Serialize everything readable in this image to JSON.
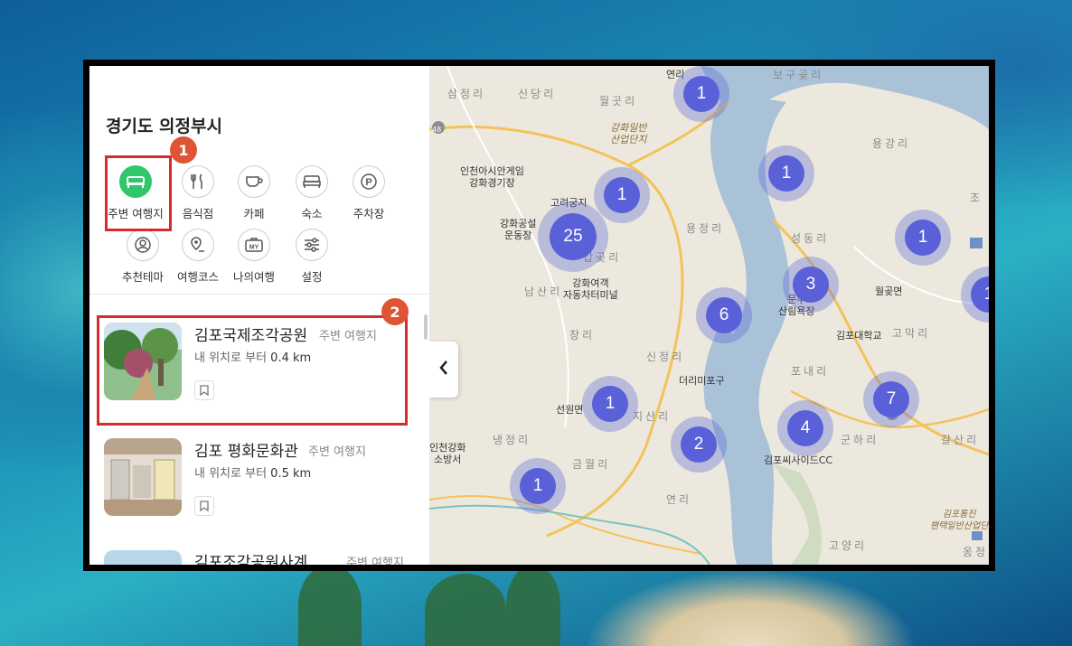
{
  "sidebar": {
    "region_title": "경기도 의정부시",
    "categories": [
      {
        "label": "주변 여행지",
        "icon": "bed-icon",
        "active": true
      },
      {
        "label": "음식점",
        "icon": "fork-knife-icon"
      },
      {
        "label": "카페",
        "icon": "coffee-cup-icon"
      },
      {
        "label": "숙소",
        "icon": "bed-outline-icon"
      },
      {
        "label": "주차장",
        "icon": "parking-icon"
      },
      {
        "label": "추천테마",
        "icon": "globe-pin-icon"
      },
      {
        "label": "여행코스",
        "icon": "route-pin-icon"
      },
      {
        "label": "나의여행",
        "icon": "my-suitcase-icon",
        "icon_text": "MY"
      },
      {
        "label": "설정",
        "icon": "sliders-icon"
      }
    ],
    "places": [
      {
        "name": "김포국제조각공원",
        "type": "주변 여행지",
        "distance_prefix": "내 위치로 부터",
        "distance": "0.4 km"
      },
      {
        "name": "김포 평화문화관",
        "type": "주변 여행지",
        "distance_prefix": "내 위치로 부터",
        "distance": "0.5 km"
      },
      {
        "name": "김포조각공원사계…",
        "type": "주변 여행지"
      }
    ],
    "annotations": [
      "1",
      "2"
    ]
  },
  "map": {
    "clusters": [
      "1",
      "1",
      "25",
      "1",
      "1",
      "3",
      "1",
      "6",
      "1",
      "7",
      "4",
      "2",
      "1"
    ],
    "road_badges": {
      "r48": "48",
      "r56": "56"
    },
    "labels": {
      "samjeong": "삼정리",
      "sindang": "신당리",
      "wolgot": "월곳리",
      "yeonri": "연리",
      "hwaseong_park": "강화일반\n산업단지",
      "asian_games": "인천아시안게임\n강화경기장",
      "goryeo": "고려궁지",
      "gangwha_stadium": "강화공설\n운동장",
      "gangwha_terminal": "강화여객\n자동차터미널",
      "gapgot": "갑곶리",
      "nansanri": "남산리",
      "changri": "창리",
      "yongjeong": "용정리",
      "yonggang": "용강리",
      "seongdong": "성동리",
      "munsu": "문수\n산림욕장",
      "wolgot_myeon": "월곶면",
      "gimpo_univ": "김포대학교",
      "gomak": "고막리",
      "poraeri": "포내리",
      "sinjeong": "신정리",
      "deori_port": "더리미포구",
      "seonwon": "선원면",
      "jisanri": "지산리",
      "nangjeong": "냉정리",
      "geumwol": "금월리",
      "yeonri2": "연리",
      "gunha": "군하리",
      "galsan": "갈산리",
      "seaside_cc": "김포씨사이드CC",
      "gimpo_tong": "김포통진\n팬택일반산업단",
      "goyang": "고양리",
      "fire": "인천강화\n소방서",
      "jo": "조",
      "ongjeong": "옹정",
      "bokuri": "보구곶리"
    }
  },
  "colors": {
    "accent_green": "#2fc76a",
    "cluster_blue": "#5a60d8",
    "highlight_red": "#d92b2b",
    "badge_orange": "#e05436"
  }
}
